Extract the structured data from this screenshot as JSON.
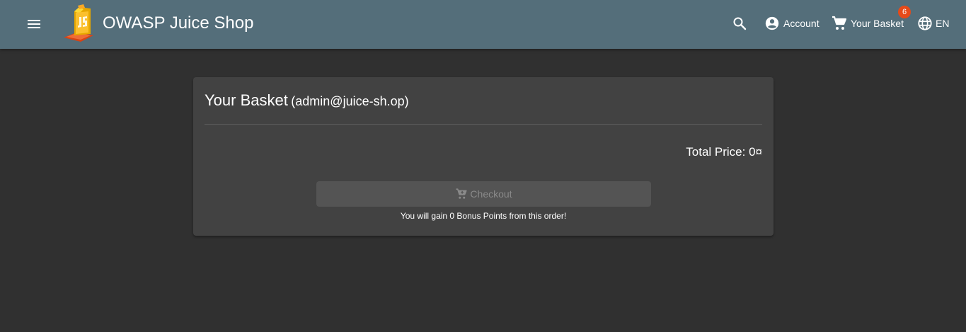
{
  "header": {
    "title": "OWASP Juice Shop",
    "account_label": "Account",
    "basket_label": "Your Basket",
    "basket_count": "6",
    "language": "EN",
    "icons": [
      "menu-icon",
      "juice-shop-logo",
      "search-icon",
      "account-circle-icon",
      "shopping-cart-icon",
      "globe-icon"
    ],
    "badge_color": "#e64a19",
    "toolbar_color": "#546e7a"
  },
  "basket": {
    "title": "Your Basket",
    "user": "(admin@juice-sh.op)",
    "total_price": "Total Price: 0¤",
    "checkout_label": "Checkout",
    "checkout_enabled": false,
    "bonus_text": "You will gain 0 Bonus Points from this order!"
  }
}
